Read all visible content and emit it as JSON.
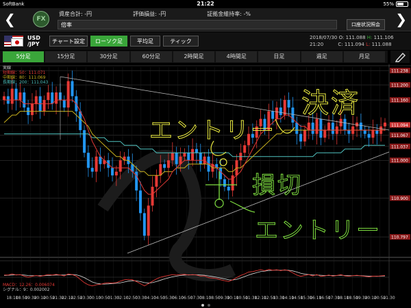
{
  "status_bar": {
    "carrier": "SoftBank",
    "time": "21:22",
    "battery": "55%",
    "battery_level": 0.55
  },
  "header": {
    "fx_logo": "FX",
    "assets_label": "資産合計: -円",
    "pl_label": "評価損益: -円",
    "margin_label": "証拠金維持率: -%",
    "ratio_field": "倍率",
    "account_button": "口座状況照会"
  },
  "pair": {
    "base": "USD",
    "quote": "/JPY",
    "chart_settings": "チャート設定",
    "candlestick": "ローソク足",
    "heikin": "平均足",
    "tick": "ティック",
    "date": "2018/07/30",
    "time": "21:20",
    "o_label": "O:",
    "o_value": "111.088",
    "h_label": "H:",
    "h_value": "111.106",
    "c_label": "C:",
    "c_value": "111.094",
    "l_label": "L:",
    "l_value": "111.088"
  },
  "timeframes": [
    "5分足",
    "15分足",
    "30分足",
    "60分足",
    "2時間足",
    "4時間足",
    "日足",
    "週足",
    "月足"
  ],
  "active_timeframe": "5分足",
  "legend": {
    "title": "実線",
    "short": "短期線：50：111.071",
    "mid": "中期線：80：111.069",
    "long": "長期線：200：111.043"
  },
  "macd_legend": {
    "macd": "MACD：12.26：0.006074",
    "signal": "シグナル：9：0.002002"
  },
  "colors": {
    "accent": "#3aa63a",
    "candle_up": "#e53935",
    "candle_down": "#2196f3",
    "ma_short": "#e53935",
    "ma_mid": "#c9b21e",
    "ma_long": "#4fc3c0",
    "annotation_yellow": "#e8e840",
    "annotation_green": "#7fe040"
  },
  "annotations": {
    "kessai": "決済",
    "entry_top": "エントリー",
    "songiri": "損切",
    "entry_bottom": "エントリー"
  },
  "chart_data": {
    "type": "line",
    "title": "USD/JPY 5分足",
    "xlabel": "",
    "ylabel": "",
    "ylim": [
      110.75,
      111.24
    ],
    "y_tick_labels": [
      "111.238",
      "111.200",
      "111.160",
      "111.094",
      "111.067",
      "111.037",
      "111.000",
      "110.900",
      "110.797"
    ],
    "current_price": 111.094,
    "x_tick_labels": [
      "18:10",
      "18:50",
      "19:30",
      "20:10",
      "20:50",
      "21:30",
      "22:10",
      "22:50",
      "23:30",
      "00:10",
      "00:50",
      "01:30",
      "02:10",
      "02:50",
      "03:30",
      "04:10",
      "04:50",
      "05:30",
      "06:10",
      "06:50",
      "07:30",
      "08:10",
      "08:50",
      "09:30",
      "10:10",
      "10:50",
      "11:30",
      "12:10",
      "12:50",
      "13:30",
      "14:10",
      "14:50",
      "15:30",
      "16:10",
      "16:50",
      "17:30",
      "18:10",
      "18:50",
      "19:30",
      "20:10",
      "20:50",
      "21:30"
    ],
    "close_series": [
      111.17,
      111.15,
      111.19,
      111.16,
      111.18,
      111.14,
      111.12,
      111.15,
      111.17,
      111.13,
      111.16,
      111.18,
      111.15,
      111.18,
      111.16,
      111.14,
      111.21,
      111.17,
      111.13,
      111.08,
      111.02,
      110.98,
      110.97,
      111.01,
      110.99,
      111.0,
      110.98,
      110.96,
      110.97,
      111.0,
      111.01,
      110.99,
      110.97,
      110.92,
      110.86,
      110.8,
      110.88,
      110.93,
      110.96,
      110.99,
      110.98,
      111.0,
      111.02,
      110.99,
      111.01,
      111.02,
      111.0,
      111.03,
      111.02,
      110.99,
      111.01,
      110.97,
      110.99,
      110.98,
      110.95,
      110.93,
      110.92,
      110.96,
      111.0,
      111.02,
      111.04,
      111.07,
      111.06,
      111.09,
      111.11,
      111.08,
      111.13,
      111.11,
      111.14,
      111.12,
      111.16,
      111.14,
      111.1,
      111.07,
      111.05,
      111.08,
      111.1,
      111.07,
      111.11,
      111.06,
      111.08,
      111.1,
      111.07,
      111.09,
      111.11,
      111.08,
      111.07,
      111.09,
      111.1,
      111.08,
      111.07,
      111.06,
      111.08,
      111.07,
      111.09,
      111.1
    ],
    "ma_short": [
      111.16,
      111.16,
      111.16,
      111.16,
      111.16,
      111.15,
      111.15,
      111.15,
      111.15,
      111.15,
      111.15,
      111.15,
      111.15,
      111.16,
      111.16,
      111.16,
      111.16,
      111.16,
      111.15,
      111.13,
      111.11,
      111.08,
      111.05,
      111.03,
      111.01,
      111.0,
      110.99,
      110.98,
      110.98,
      110.98,
      110.98,
      110.98,
      110.97,
      110.96,
      110.94,
      110.92,
      110.91,
      110.91,
      110.92,
      110.93,
      110.94,
      110.95,
      110.97,
      110.98,
      110.99,
      111.0,
      111.0,
      111.0,
      111.0,
      111.0,
      111.0,
      110.99,
      110.99,
      110.98,
      110.97,
      110.96,
      110.95,
      110.95,
      110.96,
      110.97,
      110.99,
      111.01,
      111.03,
      111.05,
      111.07,
      111.08,
      111.09,
      111.1,
      111.11,
      111.11,
      111.12,
      111.12,
      111.11,
      111.1,
      111.09,
      111.09,
      111.08,
      111.08,
      111.08,
      111.08,
      111.08,
      111.08,
      111.08,
      111.08,
      111.08,
      111.08,
      111.08,
      111.08,
      111.08,
      111.08,
      111.08,
      111.08,
      111.08,
      111.08,
      111.08,
      111.08
    ],
    "ma_mid": [
      111.1,
      111.11,
      111.12,
      111.12,
      111.13,
      111.13,
      111.13,
      111.13,
      111.13,
      111.13,
      111.13,
      111.13,
      111.13,
      111.13,
      111.13,
      111.13,
      111.13,
      111.13,
      111.12,
      111.11,
      111.1,
      111.09,
      111.07,
      111.06,
      111.05,
      111.04,
      111.03,
      111.02,
      111.01,
      111.01,
      111.0,
      111.0,
      110.99,
      110.98,
      110.97,
      110.97,
      110.96,
      110.96,
      110.96,
      110.96,
      110.97,
      110.97,
      110.97,
      110.98,
      110.98,
      110.98,
      110.99,
      110.99,
      110.99,
      110.99,
      110.99,
      110.99,
      110.98,
      110.98,
      110.98,
      110.98,
      110.97,
      110.97,
      110.98,
      110.98,
      110.99,
      111.0,
      111.01,
      111.02,
      111.03,
      111.04,
      111.05,
      111.06,
      111.07,
      111.07,
      111.08,
      111.08,
      111.08,
      111.08,
      111.08,
      111.08,
      111.08,
      111.08,
      111.08,
      111.08,
      111.08,
      111.08,
      111.08,
      111.08,
      111.08,
      111.08,
      111.08,
      111.08,
      111.08,
      111.08,
      111.08,
      111.08,
      111.08,
      111.08,
      111.08,
      111.08
    ],
    "ma_long": [
      111.07,
      111.07,
      111.07,
      111.07,
      111.07,
      111.07,
      111.07,
      111.07,
      111.07,
      111.07,
      111.07,
      111.07,
      111.07,
      111.07,
      111.07,
      111.07,
      111.07,
      111.07,
      111.07,
      111.07,
      111.07,
      111.07,
      111.06,
      111.06,
      111.06,
      111.06,
      111.05,
      111.05,
      111.05,
      111.05,
      111.04,
      111.04,
      111.04,
      111.04,
      111.03,
      111.03,
      111.03,
      111.03,
      111.02,
      111.02,
      111.02,
      111.02,
      111.02,
      111.02,
      111.02,
      111.02,
      111.02,
      111.02,
      111.02,
      111.02,
      111.02,
      111.02,
      111.02,
      111.02,
      111.02,
      111.02,
      111.02,
      111.01,
      111.01,
      111.01,
      111.01,
      111.01,
      111.01,
      111.01,
      111.01,
      111.01,
      111.01,
      111.01,
      111.01,
      111.01,
      111.01,
      111.01,
      111.01,
      111.01,
      111.01,
      111.01,
      111.01,
      111.01,
      111.02,
      111.02,
      111.02,
      111.02,
      111.02,
      111.02,
      111.02,
      111.03,
      111.03,
      111.03,
      111.03,
      111.03,
      111.04,
      111.04,
      111.04,
      111.04,
      111.04,
      111.04
    ],
    "macd_ylim": [
      -0.06,
      0.06
    ],
    "macd": [
      0.01,
      0.01,
      0.015,
      0.01,
      0.012,
      0.005,
      0.0,
      0.004,
      0.008,
      0.004,
      0.008,
      0.012,
      0.01,
      0.013,
      0.01,
      0.006,
      0.015,
      0.012,
      0.005,
      -0.01,
      -0.025,
      -0.035,
      -0.04,
      -0.035,
      -0.033,
      -0.028,
      -0.026,
      -0.027,
      -0.025,
      -0.018,
      -0.012,
      -0.01,
      -0.012,
      -0.02,
      -0.03,
      -0.04,
      -0.03,
      -0.018,
      -0.008,
      0.0,
      0.004,
      0.008,
      0.012,
      0.01,
      0.012,
      0.013,
      0.01,
      0.012,
      0.01,
      0.005,
      0.006,
      -0.002,
      -0.004,
      -0.006,
      -0.012,
      -0.016,
      -0.02,
      -0.012,
      -0.002,
      0.008,
      0.015,
      0.024,
      0.026,
      0.03,
      0.035,
      0.03,
      0.036,
      0.032,
      0.034,
      0.03,
      0.034,
      0.03,
      0.02,
      0.01,
      0.004,
      0.008,
      0.012,
      0.006,
      0.012,
      0.004,
      0.006,
      0.01,
      0.005,
      0.008,
      0.012,
      0.006,
      0.004,
      0.007,
      0.009,
      0.006,
      0.004,
      0.002,
      0.005,
      0.004,
      0.006,
      0.008
    ],
    "signal": [
      0.008,
      0.009,
      0.01,
      0.011,
      0.011,
      0.01,
      0.008,
      0.007,
      0.007,
      0.007,
      0.007,
      0.008,
      0.009,
      0.01,
      0.01,
      0.01,
      0.011,
      0.012,
      0.011,
      0.006,
      -0.002,
      -0.012,
      -0.022,
      -0.028,
      -0.031,
      -0.032,
      -0.031,
      -0.029,
      -0.028,
      -0.026,
      -0.022,
      -0.018,
      -0.016,
      -0.017,
      -0.02,
      -0.025,
      -0.027,
      -0.025,
      -0.02,
      -0.014,
      -0.008,
      -0.003,
      0.002,
      0.005,
      0.008,
      0.01,
      0.011,
      0.011,
      0.011,
      0.01,
      0.009,
      0.006,
      0.003,
      0.0,
      -0.004,
      -0.008,
      -0.012,
      -0.013,
      -0.01,
      -0.004,
      0.003,
      0.01,
      0.016,
      0.021,
      0.026,
      0.028,
      0.031,
      0.032,
      0.033,
      0.032,
      0.033,
      0.032,
      0.029,
      0.024,
      0.018,
      0.014,
      0.012,
      0.01,
      0.01,
      0.009,
      0.008,
      0.008,
      0.008,
      0.008,
      0.009,
      0.008,
      0.007,
      0.007,
      0.007,
      0.007,
      0.006,
      0.005,
      0.005,
      0.005,
      0.005,
      0.006
    ]
  }
}
